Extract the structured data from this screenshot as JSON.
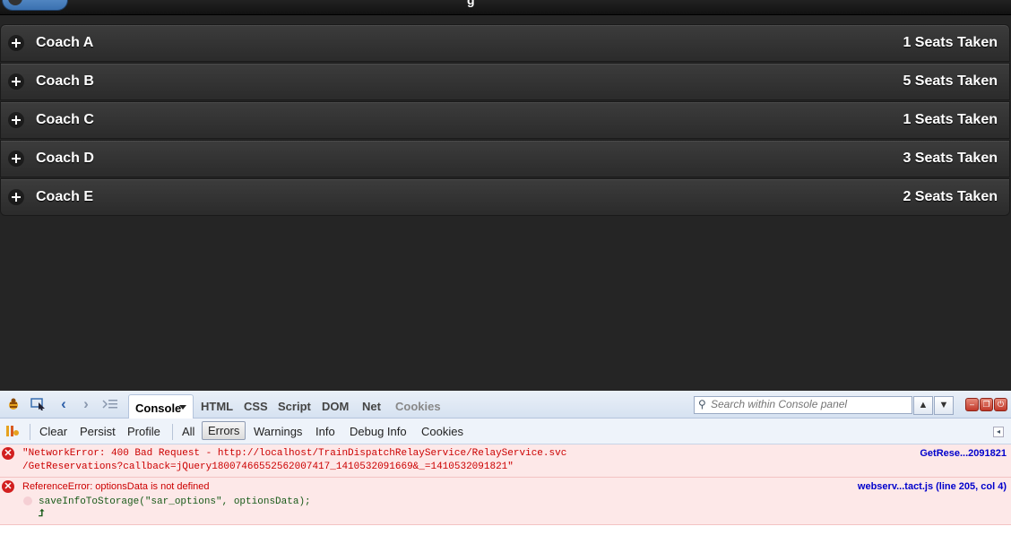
{
  "header": {
    "title_stub": "g"
  },
  "coaches": [
    {
      "name": "Coach A",
      "seats": "1 Seats Taken"
    },
    {
      "name": "Coach B",
      "seats": "5 Seats Taken"
    },
    {
      "name": "Coach C",
      "seats": "1 Seats Taken"
    },
    {
      "name": "Coach D",
      "seats": "3 Seats Taken"
    },
    {
      "name": "Coach E",
      "seats": "2 Seats Taken"
    }
  ],
  "firebug": {
    "tabs": {
      "console": "Console",
      "html": "HTML",
      "css": "CSS",
      "script": "Script",
      "dom": "DOM",
      "net": "Net",
      "cookies": "Cookies"
    },
    "search_placeholder": "Search within Console panel",
    "subbar": {
      "clear": "Clear",
      "persist": "Persist",
      "profile": "Profile",
      "all": "All",
      "errors": "Errors",
      "warnings": "Warnings",
      "info": "Info",
      "debug_info": "Debug Info",
      "cookies": "Cookies"
    },
    "log": [
      {
        "line1": "\"NetworkError: 400 Bad Request - http://localhost/TrainDispatchRelayService/RelayService.svc",
        "line2": "/GetReservations?callback=jQuery18007466552562007417_1410532091669&_=1410532091821\"",
        "source": "GetRese...2091821"
      },
      {
        "message": "ReferenceError: optionsData is not defined",
        "code": "saveInfoToStorage(\"sar_options\", optionsData);",
        "source": "webserv...tact.js (line 205, col 4)"
      }
    ]
  }
}
